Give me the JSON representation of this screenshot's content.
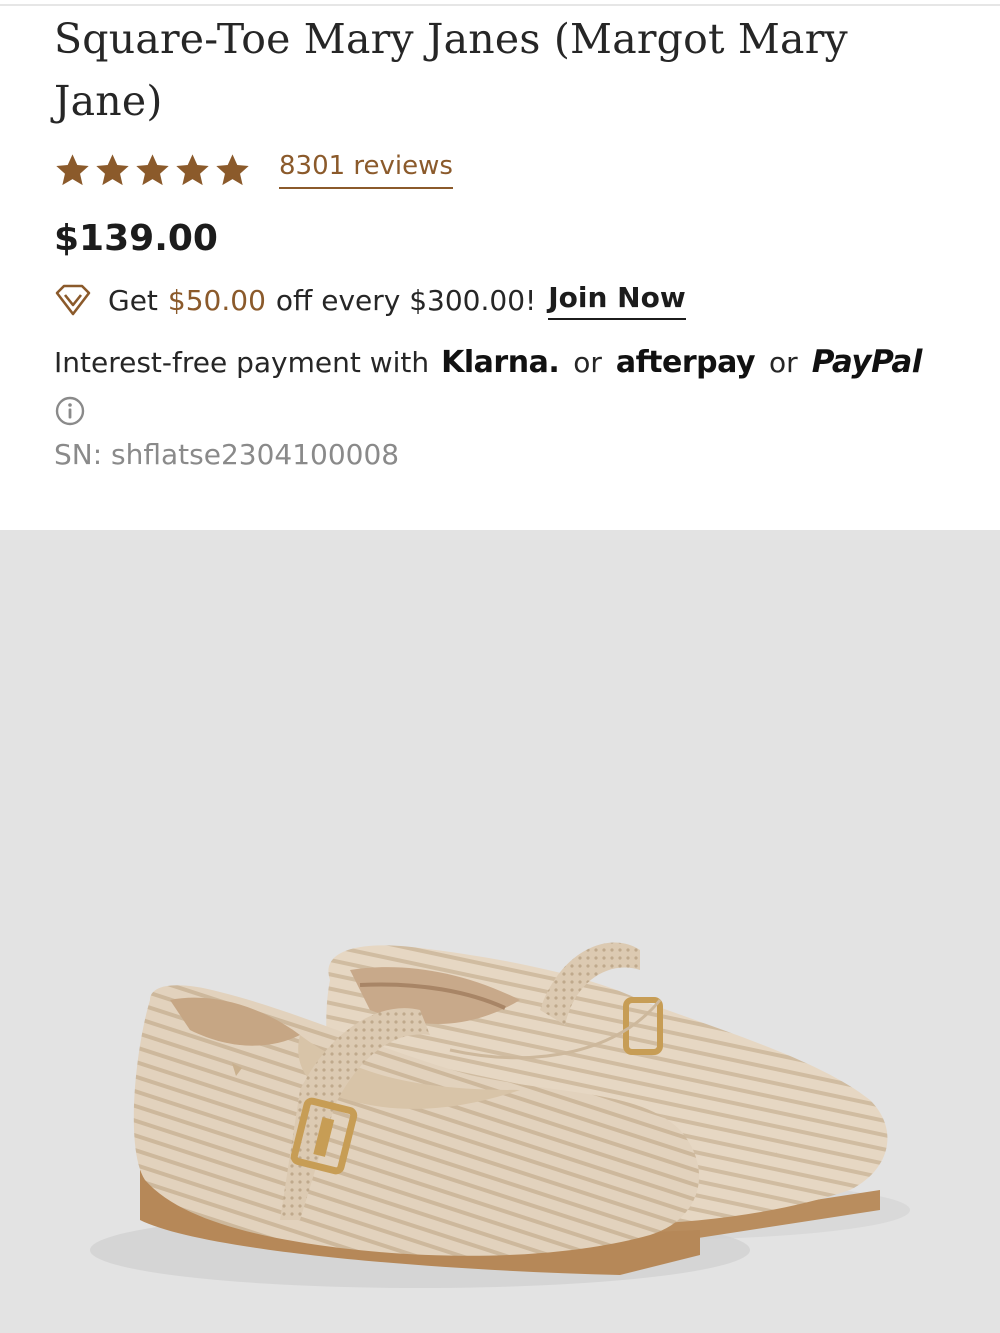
{
  "product": {
    "title": "Square-Toe Mary Janes (Margot Mary Jane)",
    "rating": 5,
    "rating_max": 5,
    "reviews_label": "8301 reviews",
    "price": "$139.00",
    "sn": "SN: shflatse2304100008"
  },
  "promo": {
    "icon": "diamond-icon",
    "prefix": "Get",
    "amount": "$50.00",
    "suffix": "off every $300.00!",
    "join_label": "Join Now"
  },
  "payment": {
    "intro": "Interest-free payment with",
    "klarna": "Klarna.",
    "or1": "or",
    "afterpay": "afterpay",
    "or2": "or",
    "paypal": "PayPal",
    "info_icon": "info-icon"
  },
  "colors": {
    "accent_brown": "#8b5a2b",
    "star_color": "#8b5a2b",
    "image_background": "#e3e3e3",
    "sn_gray": "#8a8a8a"
  },
  "image": {
    "alt_name": "product-image-mary-janes"
  }
}
